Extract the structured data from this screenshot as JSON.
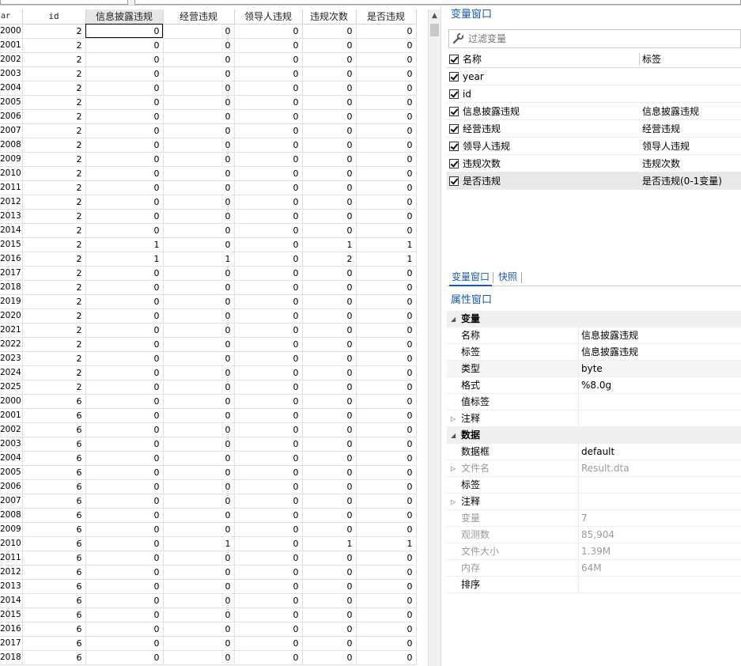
{
  "grid": {
    "columns": [
      "ar",
      "id",
      "信息披露违规",
      "经营违规",
      "领导人违规",
      "违规次数",
      "是否违规"
    ],
    "rows": [
      [
        "2000",
        "2",
        "0",
        "0",
        "0",
        "0",
        "0"
      ],
      [
        "2001",
        "2",
        "0",
        "0",
        "0",
        "0",
        "0"
      ],
      [
        "2002",
        "2",
        "0",
        "0",
        "0",
        "0",
        "0"
      ],
      [
        "2003",
        "2",
        "0",
        "0",
        "0",
        "0",
        "0"
      ],
      [
        "2004",
        "2",
        "0",
        "0",
        "0",
        "0",
        "0"
      ],
      [
        "2005",
        "2",
        "0",
        "0",
        "0",
        "0",
        "0"
      ],
      [
        "2006",
        "2",
        "0",
        "0",
        "0",
        "0",
        "0"
      ],
      [
        "2007",
        "2",
        "0",
        "0",
        "0",
        "0",
        "0"
      ],
      [
        "2008",
        "2",
        "0",
        "0",
        "0",
        "0",
        "0"
      ],
      [
        "2009",
        "2",
        "0",
        "0",
        "0",
        "0",
        "0"
      ],
      [
        "2010",
        "2",
        "0",
        "0",
        "0",
        "0",
        "0"
      ],
      [
        "2011",
        "2",
        "0",
        "0",
        "0",
        "0",
        "0"
      ],
      [
        "2012",
        "2",
        "0",
        "0",
        "0",
        "0",
        "0"
      ],
      [
        "2013",
        "2",
        "0",
        "0",
        "0",
        "0",
        "0"
      ],
      [
        "2014",
        "2",
        "0",
        "0",
        "0",
        "0",
        "0"
      ],
      [
        "2015",
        "2",
        "1",
        "0",
        "0",
        "1",
        "1"
      ],
      [
        "2016",
        "2",
        "1",
        "1",
        "0",
        "2",
        "1"
      ],
      [
        "2017",
        "2",
        "0",
        "0",
        "0",
        "0",
        "0"
      ],
      [
        "2018",
        "2",
        "0",
        "0",
        "0",
        "0",
        "0"
      ],
      [
        "2019",
        "2",
        "0",
        "0",
        "0",
        "0",
        "0"
      ],
      [
        "2020",
        "2",
        "0",
        "0",
        "0",
        "0",
        "0"
      ],
      [
        "2021",
        "2",
        "0",
        "0",
        "0",
        "0",
        "0"
      ],
      [
        "2022",
        "2",
        "0",
        "0",
        "0",
        "0",
        "0"
      ],
      [
        "2023",
        "2",
        "0",
        "0",
        "0",
        "0",
        "0"
      ],
      [
        "2024",
        "2",
        "0",
        "0",
        "0",
        "0",
        "0"
      ],
      [
        "2025",
        "2",
        "0",
        "0",
        "0",
        "0",
        "0"
      ],
      [
        "2000",
        "6",
        "0",
        "0",
        "0",
        "0",
        "0"
      ],
      [
        "2001",
        "6",
        "0",
        "0",
        "0",
        "0",
        "0"
      ],
      [
        "2002",
        "6",
        "0",
        "0",
        "0",
        "0",
        "0"
      ],
      [
        "2003",
        "6",
        "0",
        "0",
        "0",
        "0",
        "0"
      ],
      [
        "2004",
        "6",
        "0",
        "0",
        "0",
        "0",
        "0"
      ],
      [
        "2005",
        "6",
        "0",
        "0",
        "0",
        "0",
        "0"
      ],
      [
        "2006",
        "6",
        "0",
        "0",
        "0",
        "0",
        "0"
      ],
      [
        "2007",
        "6",
        "0",
        "0",
        "0",
        "0",
        "0"
      ],
      [
        "2008",
        "6",
        "0",
        "0",
        "0",
        "0",
        "0"
      ],
      [
        "2009",
        "6",
        "0",
        "0",
        "0",
        "0",
        "0"
      ],
      [
        "2010",
        "6",
        "0",
        "1",
        "0",
        "1",
        "1"
      ],
      [
        "2011",
        "6",
        "0",
        "0",
        "0",
        "0",
        "0"
      ],
      [
        "2012",
        "6",
        "0",
        "0",
        "0",
        "0",
        "0"
      ],
      [
        "2013",
        "6",
        "0",
        "0",
        "0",
        "0",
        "0"
      ],
      [
        "2014",
        "6",
        "0",
        "0",
        "0",
        "0",
        "0"
      ],
      [
        "2015",
        "6",
        "0",
        "0",
        "0",
        "0",
        "0"
      ],
      [
        "2016",
        "6",
        "0",
        "0",
        "0",
        "0",
        "0"
      ],
      [
        "2017",
        "6",
        "0",
        "0",
        "0",
        "0",
        "0"
      ],
      [
        "2018",
        "6",
        "0",
        "0",
        "0",
        "0",
        "0"
      ]
    ]
  },
  "variables_window": {
    "title": "变量窗口",
    "filter_placeholder": "过滤变量",
    "header_name": "名称",
    "header_label": "标签",
    "items": [
      {
        "name": "year",
        "label": ""
      },
      {
        "name": "id",
        "label": ""
      },
      {
        "name": "信息披露违规",
        "label": "信息披露违规"
      },
      {
        "name": "经营违规",
        "label": "经营违规"
      },
      {
        "name": "领导人违规",
        "label": "领导人违规"
      },
      {
        "name": "违规次数",
        "label": "违规次数"
      },
      {
        "name": "是否违规",
        "label": "是否违规(0-1变量)"
      }
    ]
  },
  "tabs": [
    "变量窗口",
    "快照"
  ],
  "properties_window": {
    "title": "属性窗口",
    "variable_section": "变量",
    "variable_rows": [
      {
        "key": "名称",
        "value": "信息披露违规"
      },
      {
        "key": "标签",
        "value": "信息披露违规"
      },
      {
        "key": "类型",
        "value": "byte"
      },
      {
        "key": "格式",
        "value": "%8.0g"
      },
      {
        "key": "值标签",
        "value": ""
      },
      {
        "key": "注释",
        "value": ""
      }
    ],
    "data_section": "数据",
    "data_rows": [
      {
        "key": "数据框",
        "value": "default"
      },
      {
        "key": "文件名",
        "value": "Result.dta"
      },
      {
        "key": "标签",
        "value": ""
      },
      {
        "key": "注释",
        "value": ""
      },
      {
        "key": "变量",
        "value": "7"
      },
      {
        "key": "观测数",
        "value": "85,904"
      },
      {
        "key": "文件大小",
        "value": "1.39M"
      },
      {
        "key": "内存",
        "value": "64M"
      },
      {
        "key": "排序",
        "value": ""
      }
    ]
  }
}
